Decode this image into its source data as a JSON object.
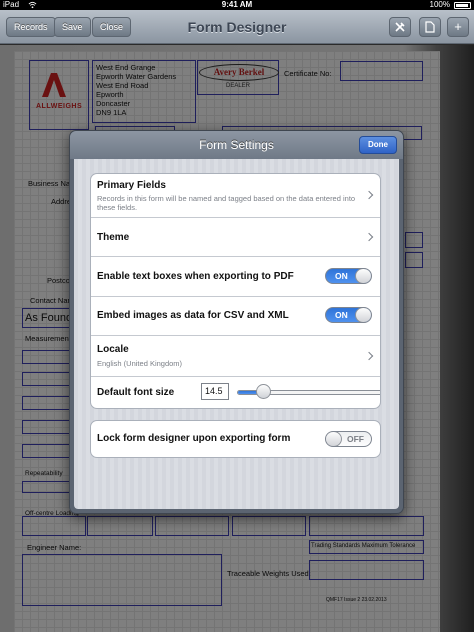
{
  "status_bar": {
    "carrier": "iPad",
    "time": "9:41 AM",
    "battery": "100%"
  },
  "nav": {
    "records_label": "Records",
    "save_label": "Save",
    "close_label": "Close",
    "title": "Form Designer",
    "icons": [
      "tools-icon",
      "document-icon",
      "plus-icon"
    ]
  },
  "form": {
    "address": [
      "West End Grange",
      "Epworth Water Gardens",
      "West End Road",
      "Epworth",
      "Doncaster",
      "DN9 1LA"
    ],
    "logo_text": "ALLWEIGHS",
    "brand": "Avery Berkel",
    "brand_sub": "DEALER",
    "certificate_label": "Certificate No:",
    "business_label": "Business Nam",
    "address_label": "Addre",
    "postcode_label": "Postco",
    "contact_label": "Contact Nam",
    "as_found_label": "As Found",
    "measurement_label": "Measurement R",
    "repeatability_label": "Repeatability",
    "off_centre_label": "Off-centre Loading",
    "engineer_label": "Engineer Name:",
    "tolerance_label": "Trading Standards Maximum Tolerance",
    "weights_label": "Traceable Weights Used:",
    "footer_code": "QMF17 Issue 2 23.02.2013"
  },
  "popover": {
    "title": "Form Settings",
    "done_label": "Done",
    "primary_fields": {
      "title": "Primary Fields",
      "subtitle": "Records in this form will be named and tagged based on the data entered into these fields."
    },
    "theme": {
      "title": "Theme"
    },
    "enable_text_boxes": {
      "title": "Enable text boxes when exporting to PDF",
      "state": "ON"
    },
    "embed_images": {
      "title": "Embed images as data for CSV and XML",
      "state": "ON"
    },
    "locale": {
      "title": "Locale",
      "subtitle": "English (United Kingdom)"
    },
    "font_size": {
      "title": "Default font size",
      "value": "14.5",
      "slider_fraction": 0.18
    },
    "lock_designer": {
      "title": "Lock form designer upon exporting form",
      "state": "OFF"
    }
  }
}
